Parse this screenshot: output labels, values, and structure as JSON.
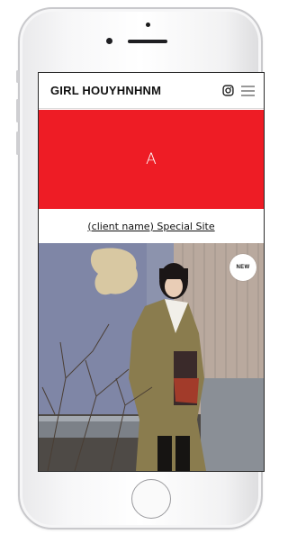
{
  "header": {
    "brand": "GIRL HOUYHNHNM",
    "icons": [
      "instagram-icon",
      "hamburger-menu-icon"
    ]
  },
  "banner": {
    "text": "A",
    "color": "#ee1c25"
  },
  "special_link": {
    "label": "(client name) Special Site"
  },
  "feature": {
    "badge": "NEW",
    "image": "photo of a woman in an olive trench coat beside a pipe and corrugated wall"
  },
  "device": {
    "type": "smartphone-mockup"
  }
}
